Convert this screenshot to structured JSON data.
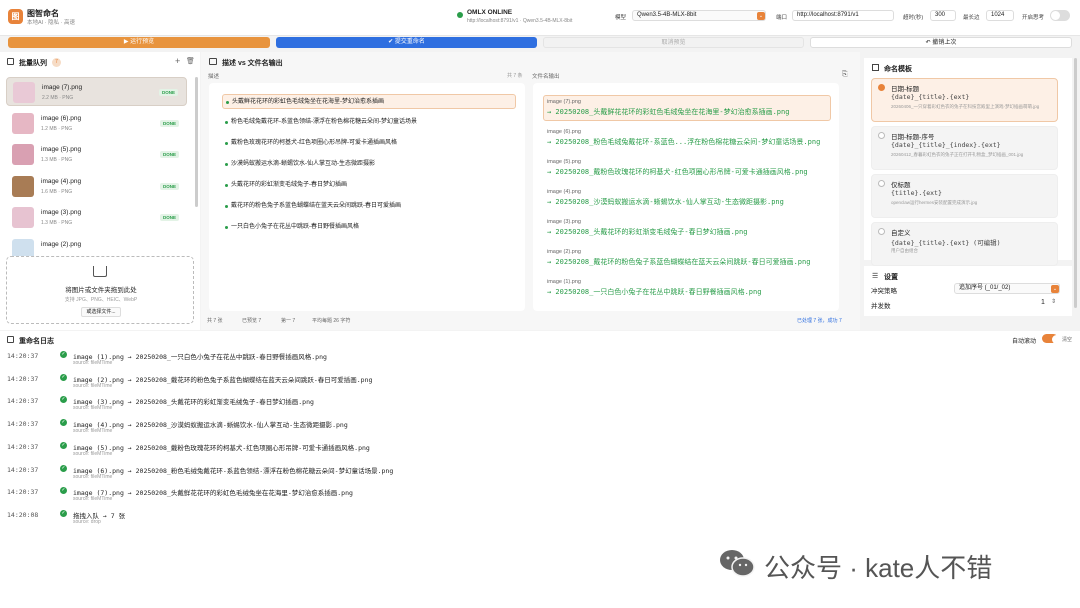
{
  "app": {
    "title": "图智命名",
    "subtitle": "本地AI · 隐私 · 高速",
    "logo_text": "图"
  },
  "server": {
    "status": "OMLX ONLINE",
    "url": "http://localhost:8791/v1 · Qwen3.5-4B-MLX-8bit"
  },
  "settings_bar": {
    "model_label": "模型",
    "model_value": "Qwen3.5-4B-MLX-8bit",
    "port_label": "端口",
    "port_value": "http://localhost:8791/v1",
    "timeout_label": "超时(秒)",
    "timeout_value": "300",
    "maxlen_label": "最长边",
    "maxlen_value": "1024",
    "think_label": "开启思考",
    "think_on": false
  },
  "actions": {
    "run_preview": "运行预览",
    "submit_rename": "提交重命名",
    "cancel_preview": "取消预览",
    "undo": "撤销上次"
  },
  "queue": {
    "title": "批量队列",
    "count": "7",
    "items": [
      {
        "name": "image (7).png",
        "size": "2.2 MB",
        "type": "PNG",
        "status": "DONE",
        "color": "#e9c9d6"
      },
      {
        "name": "image (6).png",
        "size": "1.2 MB",
        "type": "PNG",
        "status": "DONE",
        "color": "#e6b7c4"
      },
      {
        "name": "image (5).png",
        "size": "1.3 MB",
        "type": "PNG",
        "status": "DONE",
        "color": "#d9a0b2"
      },
      {
        "name": "image (4).png",
        "size": "1.6 MB",
        "type": "PNG",
        "status": "DONE",
        "color": "#a87c55"
      },
      {
        "name": "image (3).png",
        "size": "1.3 MB",
        "type": "PNG",
        "status": "DONE",
        "color": "#e7c3d1"
      },
      {
        "name": "image (2).png",
        "size": "",
        "type": "",
        "status": "",
        "color": "#cfe0ee"
      }
    ],
    "drop_title": "将图片或文件夹拖到此处",
    "drop_sub": "支持 JPG、PNG、HEIC、WebP",
    "drop_button": "或选择文件..."
  },
  "compare": {
    "title": "描述 vs 文件名输出",
    "desc_label": "描述",
    "desc_count": "共 7 条",
    "out_label": "文件名输出",
    "descs": [
      "头戴鲜花花环的彩虹色毛绒兔坐在花海里-梦幻治愈系插画",
      "粉色毛绒兔戴花环-系蓝色领结-漂浮在粉色棉花糖云朵间-梦幻童话场景",
      "戴粉色玫瑰花环的柯基犬-红色项圈心形吊牌-可爱卡通插画风格",
      "沙漠蚂蚁搬运水滴-蜥蜴饮水-仙人掌互动-生态微距摄影",
      "头戴花环的彩虹渐变毛绒兔子-春日梦幻插画",
      "戴花环的粉色兔子系蓝色蝴蝶结在蓝天云朵间跳跃-春日可爱插画",
      "一只白色小兔子在花丛中跳跃-春日野餐插画风格"
    ],
    "outputs": [
      {
        "src": "image (7).png",
        "dst": "→ 20250208_头戴鲜花花环的彩虹色毛绒兔坐在花海里-梦幻治愈系插画.png"
      },
      {
        "src": "image (6).png",
        "dst": "→ 20250208_粉色毛绒兔戴花环-系蓝色...浮在粉色棉花糖云朵间-梦幻童话场景.png"
      },
      {
        "src": "image (5).png",
        "dst": "→ 20250208_戴粉色玫瑰花环的柯基犬-红色项圈心形吊牌-可爱卡通插画风格.png"
      },
      {
        "src": "image (4).png",
        "dst": "→ 20250208_沙漠蚂蚁搬运水滴-蜥蜴饮水-仙人掌互动-生态微距摄影.png"
      },
      {
        "src": "image (3).png",
        "dst": "→ 20250208_头戴花环的彩虹渐变毛绒兔子-春日梦幻插画.png"
      },
      {
        "src": "image (2).png",
        "dst": "→ 20250208_戴花环的粉色兔子系蓝色蝴蝶结在蓝天云朵间跳跃-春日可爱插画.png"
      },
      {
        "src": "image (1).png",
        "dst": "→ 20250208_一只白色小兔子在花丛中跳跃-春日野餐插画风格.png"
      }
    ],
    "footer_total": "共 7 张",
    "footer_preview": "已预览 7",
    "footer_page": "第一 7",
    "footer_avg": "平均每题 26 字符",
    "footer_done": "已处理 7 张，成功 7"
  },
  "templates": {
    "title": "命名模板",
    "items": [
      {
        "name": "日期-标题",
        "fmt": "{date}_{title}.{ext}",
        "example": "20260406_一只穿着彩虹色衣的兔子在科技宫殿里上演戏-梦幻插画萌萌.jpg",
        "selected": true
      },
      {
        "name": "日期-标题-序号",
        "fmt": "{date}_{title}_{index}.{ext}",
        "example": "20260412_春暮彩虹色衣的兔子正在打开礼物盒_梦幻插画_001.jpg",
        "selected": false
      },
      {
        "name": "仅标题",
        "fmt": "{title}.{ext}",
        "example": "openclaw运行hermes安装配置完成演示.jpg",
        "selected": false
      },
      {
        "name": "自定义",
        "fmt": "{date}_{title}.{ext}  (可编辑)",
        "example": "用户自由组合",
        "selected": false
      }
    ]
  },
  "settings": {
    "title": "设置",
    "conflict_label": "冲突策略",
    "conflict_value": "追加序号 (_01/_02)",
    "concurrency_label": "并发数",
    "concurrency_value": "1"
  },
  "log": {
    "title": "重命名日志",
    "autoscroll_label": "自动滚动",
    "clear_label": "清空",
    "rows": [
      {
        "time": "14:20:37",
        "msg": "image (1).png → 20250208_一只白色小兔子在花丛中跳跃-春日野餐插画风格.png",
        "src": "source: fileMTime"
      },
      {
        "time": "14:20:37",
        "msg": "image (2).png → 20250208_戴花环的粉色兔子系蓝色蝴蝶结在蓝天云朵间跳跃-春日可爱插画.png",
        "src": "source: fileMTime"
      },
      {
        "time": "14:20:37",
        "msg": "image (3).png → 20250208_头戴花环的彩虹渐变毛绒兔子-春日梦幻插画.png",
        "src": "source: fileMTime"
      },
      {
        "time": "14:20:37",
        "msg": "image (4).png → 20250208_沙漠蚂蚁搬运水滴-蜥蜴饮水-仙人掌互动-生态微距摄影.png",
        "src": "source: fileMTime"
      },
      {
        "time": "14:20:37",
        "msg": "image (5).png → 20250208_戴粉色玫瑰花环的柯基犬-红色项圈心形吊牌-可爱卡通插画风格.png",
        "src": "source: fileMTime"
      },
      {
        "time": "14:20:37",
        "msg": "image (6).png → 20250208_粉色毛绒兔戴花环-系蓝色领结-漂浮在粉色棉花糖云朵间-梦幻童话场景.png",
        "src": "source: fileMTime"
      },
      {
        "time": "14:20:37",
        "msg": "image (7).png → 20250208_头戴鲜花花环的彩虹色毛绒兔坐在花海里-梦幻治愈系插画.png",
        "src": "source: fileMTime"
      },
      {
        "time": "14:20:08",
        "msg": "拖拽入队 → 7 张",
        "src": "source: drop"
      }
    ]
  },
  "watermark": "公众号 · kate人不错",
  "colors": {
    "accent": "#e8833a",
    "primary": "#2f6fe0",
    "success": "#2a9d4a"
  }
}
